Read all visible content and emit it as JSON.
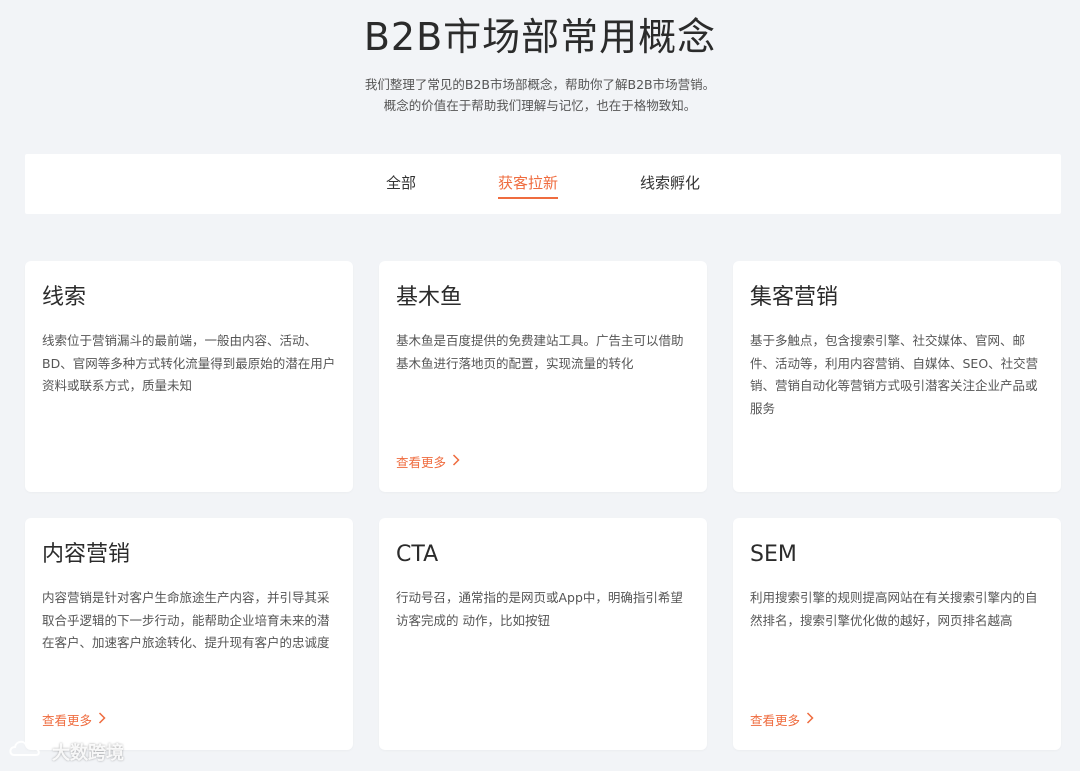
{
  "hero": {
    "title": "B2B市场部常用概念",
    "line1": "我们整理了常见的B2B市场部概念，帮助你了解B2B市场营销。",
    "line2": "概念的价值在于帮助我们理解与记忆，也在于格物致知。"
  },
  "tabs": [
    {
      "label": "全部",
      "active": false
    },
    {
      "label": "获客拉新",
      "active": true
    },
    {
      "label": "线索孵化",
      "active": false
    }
  ],
  "accent_color": "#ef6c3f",
  "cards": [
    {
      "title": "线索",
      "desc": "线索位于营销漏斗的最前端，一般由内容、活动、BD、官网等多种方式转化流量得到最原始的潜在用户资料或联系方式，质量未知",
      "more": ""
    },
    {
      "title": "基木鱼",
      "desc": "基木鱼是百度提供的免费建站工具。广告主可以借助基木鱼进行落地页的配置，实现流量的转化",
      "more": "查看更多"
    },
    {
      "title": "集客营销",
      "desc": "基于多触点，包含搜索引擎、社交媒体、官网、邮件、活动等，利用内容营销、自媒体、SEO、社交营销、营销自动化等营销方式吸引潜客关注企业产品或服务",
      "more": ""
    },
    {
      "title": "内容营销",
      "desc": "内容营销是针对客户生命旅途生产内容，并引导其采取合乎逻辑的下一步行动，能帮助企业培育未来的潜在客户、加速客户旅途转化、提升现有客户的忠诚度",
      "more": "查看更多"
    },
    {
      "title": "CTA",
      "desc": "行动号召，通常指的是网页或App中，明确指引希望访客完成的 动作，比如按钮",
      "more": ""
    },
    {
      "title": "SEM",
      "desc": "利用搜索引擎的规则提高网站在有关搜索引擎内的自然排名，搜索引擎优化做的越好，网页排名越高",
      "more": "查看更多"
    }
  ],
  "watermark": {
    "text": "大数跨境",
    "icon": "cloud-logo-icon"
  }
}
